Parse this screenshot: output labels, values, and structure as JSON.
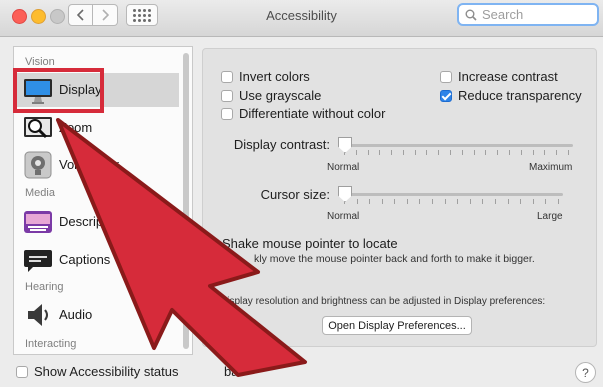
{
  "window": {
    "title": "Accessibility"
  },
  "search": {
    "placeholder": "Search"
  },
  "sidebar": {
    "sections": [
      "Vision",
      "Media",
      "Hearing",
      "Interacting"
    ],
    "items": [
      {
        "label": "Display",
        "icon": "display-icon"
      },
      {
        "label": "Zoom",
        "icon": "zoom-icon"
      },
      {
        "label": "VoiceOver",
        "icon": "voiceover-icon"
      },
      {
        "label": "Descriptions",
        "icon": "descriptions-icon"
      },
      {
        "label": "Captions",
        "icon": "captions-icon"
      },
      {
        "label": "Audio",
        "icon": "audio-icon"
      }
    ]
  },
  "options": {
    "invert_colors": {
      "label": "Invert colors",
      "checked": false
    },
    "use_grayscale": {
      "label": "Use grayscale",
      "checked": false
    },
    "differentiate": {
      "label": "Differentiate without color",
      "checked": false
    },
    "increase_contrast": {
      "label": "Increase contrast",
      "checked": false
    },
    "reduce_transparency": {
      "label": "Reduce transparency",
      "checked": true
    }
  },
  "sliders": {
    "contrast": {
      "label": "Display contrast:",
      "min_label": "Normal",
      "max_label": "Maximum",
      "value": 0
    },
    "cursor": {
      "label": "Cursor size:",
      "min_label": "Normal",
      "max_label": "Large",
      "value": 0
    }
  },
  "shake": {
    "label": "Shake mouse pointer to locate",
    "description": "kly move the mouse pointer back and forth to make it bigger."
  },
  "display_note": "Display resolution and brightness can be adjusted in Display preferences:",
  "open_display_button": "Open Display Preferences...",
  "footer": {
    "show_status_label": "Show Accessibility status",
    "status_label_tail": "bar",
    "help": "?"
  },
  "annotation": {
    "color": "#d62b3a"
  }
}
